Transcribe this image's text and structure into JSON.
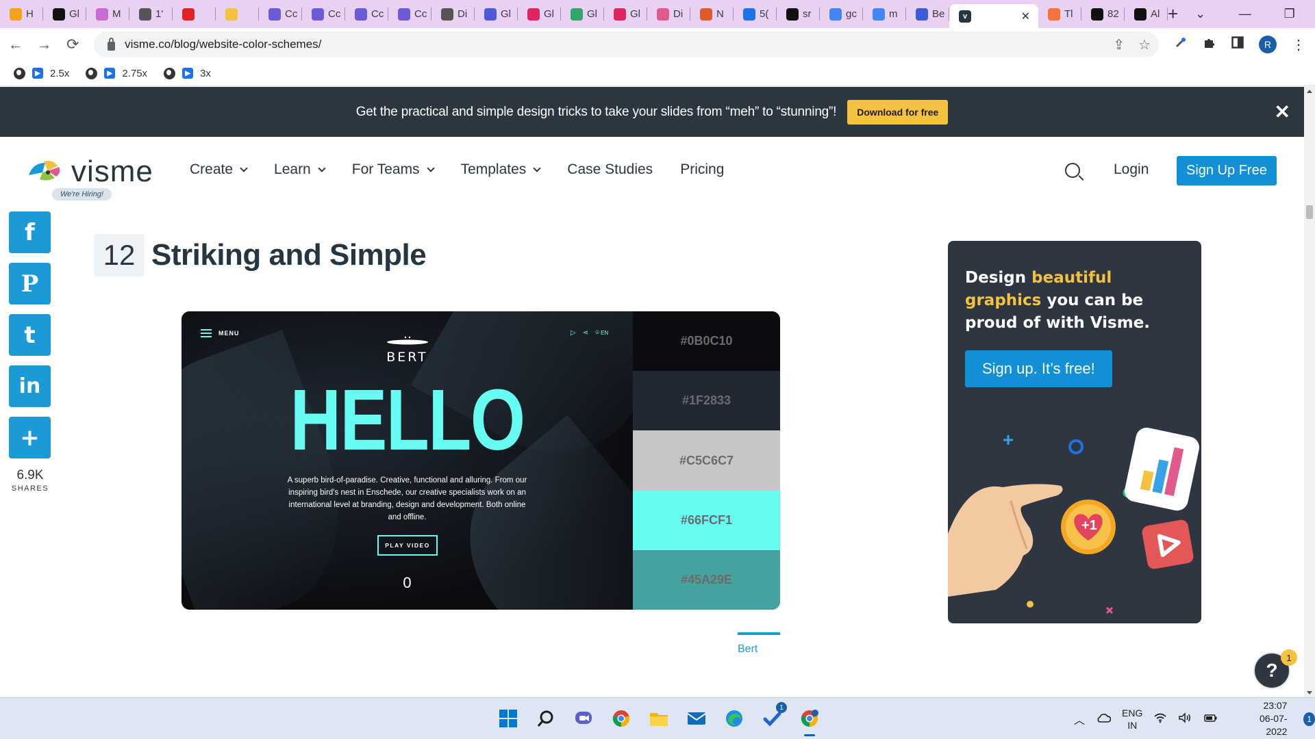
{
  "browser": {
    "tabs": [
      {
        "label": "H",
        "favicon": "sun-icon",
        "color": "#f4a21e"
      },
      {
        "label": "Gl",
        "favicon": "app-icon",
        "color": "#111111"
      },
      {
        "label": "M",
        "favicon": "mail-icon",
        "color": "#c96bd6"
      },
      {
        "label": "1'",
        "favicon": "globe-icon",
        "color": "#555555"
      },
      {
        "label": "",
        "favicon": "pen-icon",
        "color": "#e02424"
      },
      {
        "label": "",
        "favicon": "hand-icon",
        "color": "#f5c23f"
      },
      {
        "label": "Cc",
        "favicon": "cloud-icon",
        "color": "#6b5bd6"
      },
      {
        "label": "Cc",
        "favicon": "cloud-icon",
        "color": "#6b5bd6"
      },
      {
        "label": "Cc",
        "favicon": "cloud-icon",
        "color": "#6b5bd6"
      },
      {
        "label": "Cc",
        "favicon": "cloud-icon",
        "color": "#6b5bd6"
      },
      {
        "label": "Di",
        "favicon": "globe-icon",
        "color": "#555555"
      },
      {
        "label": "Gl",
        "favicon": "arrow-icon",
        "color": "#4b5bd6"
      },
      {
        "label": "Gl",
        "favicon": "circle-icon",
        "color": "#e0245e"
      },
      {
        "label": "Gl",
        "favicon": "leaf-icon",
        "color": "#2fa86a"
      },
      {
        "label": "Gl",
        "favicon": "circle-icon",
        "color": "#e0245e"
      },
      {
        "label": "Di",
        "favicon": "ball-icon",
        "color": "#e0588c"
      },
      {
        "label": "N",
        "favicon": "wave-icon",
        "color": "#e05a2b"
      },
      {
        "label": "5(",
        "favicon": "c-icon",
        "color": "#1a73e8"
      },
      {
        "label": "sr",
        "favicon": "target-icon",
        "color": "#111111"
      },
      {
        "label": "gc",
        "favicon": "google-icon",
        "color": "#4285f4"
      },
      {
        "label": "m",
        "favicon": "google-icon",
        "color": "#4285f4"
      },
      {
        "label": "Be",
        "favicon": "shield-icon",
        "color": "#3b5bdb"
      }
    ],
    "active_tab": {
      "favicon": "visme-icon",
      "close": "✕"
    },
    "tabs_after": [
      {
        "label": "Tl",
        "favicon": "bolt-icon",
        "color": "#f4733a"
      },
      {
        "label": "82",
        "favicon": "c-icon",
        "color": "#111111"
      },
      {
        "label": "Al",
        "favicon": "face-icon",
        "color": "#111111"
      }
    ],
    "new_tab": "+",
    "window_controls": {
      "menu": "⌄",
      "minimize": "—",
      "restore": "❐",
      "close": "✕"
    },
    "nav": {
      "back": "←",
      "forward": "→",
      "reload": "⟳"
    },
    "url": "visme.co/blog/website-color-schemes/",
    "omnibox_icons": {
      "share": "⇪",
      "star": "☆"
    },
    "profile_initial": "R",
    "bookmarks": [
      {
        "label": "2.5x"
      },
      {
        "label": "2.75x"
      },
      {
        "label": "3x"
      }
    ]
  },
  "promo": {
    "text": "Get the practical and simple design tricks to take your slides from “meh” to “stunning”!",
    "button": "Download for free",
    "close": "✕"
  },
  "site_nav": {
    "logo": "visme",
    "hiring_badge": "We're Hiring!",
    "menu": [
      {
        "label": "Create",
        "dropdown": true
      },
      {
        "label": "Learn",
        "dropdown": true
      },
      {
        "label": "For Teams",
        "dropdown": true
      },
      {
        "label": "Templates",
        "dropdown": true
      },
      {
        "label": "Case Studies",
        "dropdown": false
      },
      {
        "label": "Pricing",
        "dropdown": false
      }
    ],
    "login": "Login",
    "signup": "Sign Up Free"
  },
  "share": {
    "buttons": [
      {
        "glyph": "f",
        "name": "facebook"
      },
      {
        "glyph": "P",
        "name": "pinterest"
      },
      {
        "glyph": "t",
        "name": "twitter"
      },
      {
        "glyph": "in",
        "name": "linkedin"
      },
      {
        "glyph": "+",
        "name": "more"
      }
    ],
    "count": "6.9K",
    "label": "SHARES"
  },
  "article": {
    "number": "12",
    "title": "Striking and Simple",
    "preview": {
      "menu": "MENU",
      "brand": "BERT",
      "lang": "EN",
      "headline": "HELLO",
      "body": "A superb bird-of-paradise. Creative, functional and alluring. From our inspiring bird's nest in Enschede, our creative specialists work on an international level at branding, design and development. Both online and offline.",
      "button": "PLAY VIDEO",
      "counter": "0"
    },
    "palette": [
      {
        "hex": "#0B0C10",
        "label_color": "#6b6b6b"
      },
      {
        "hex": "#1F2833",
        "label_color": "#6b6b6b"
      },
      {
        "hex": "#C5C6C7",
        "label_color": "#6b6b6b"
      },
      {
        "hex": "#66FCF1",
        "label_color": "#6b6b6b"
      },
      {
        "hex": "#45A29E",
        "label_color": "#6b6b6b"
      }
    ],
    "tab_label": "Bert"
  },
  "ad": {
    "lead": "Design ",
    "highlight": "beautiful graphics",
    "rest": " you can be proud of with Visme.",
    "button": "Sign up. It’s free!",
    "badge": "+1"
  },
  "help": {
    "glyph": "?",
    "badge": "1"
  },
  "taskbar": {
    "apps": [
      "windows-start-icon",
      "search-icon",
      "chat-icon",
      "chrome-icon",
      "file-explorer-icon",
      "mail-icon",
      "edge-icon",
      "todo-icon",
      "chrome-profile-icon"
    ],
    "todo_badge": "1",
    "lang_top": "ENG",
    "lang_bottom": "IN",
    "time": "23:07",
    "date": "06-07-2022",
    "notifications": "1"
  },
  "colors": {
    "brand_blue": "#1190d8",
    "accent_yellow": "#f5c23f",
    "dark_slate": "#2c3641",
    "teal": "#66fcf1"
  }
}
